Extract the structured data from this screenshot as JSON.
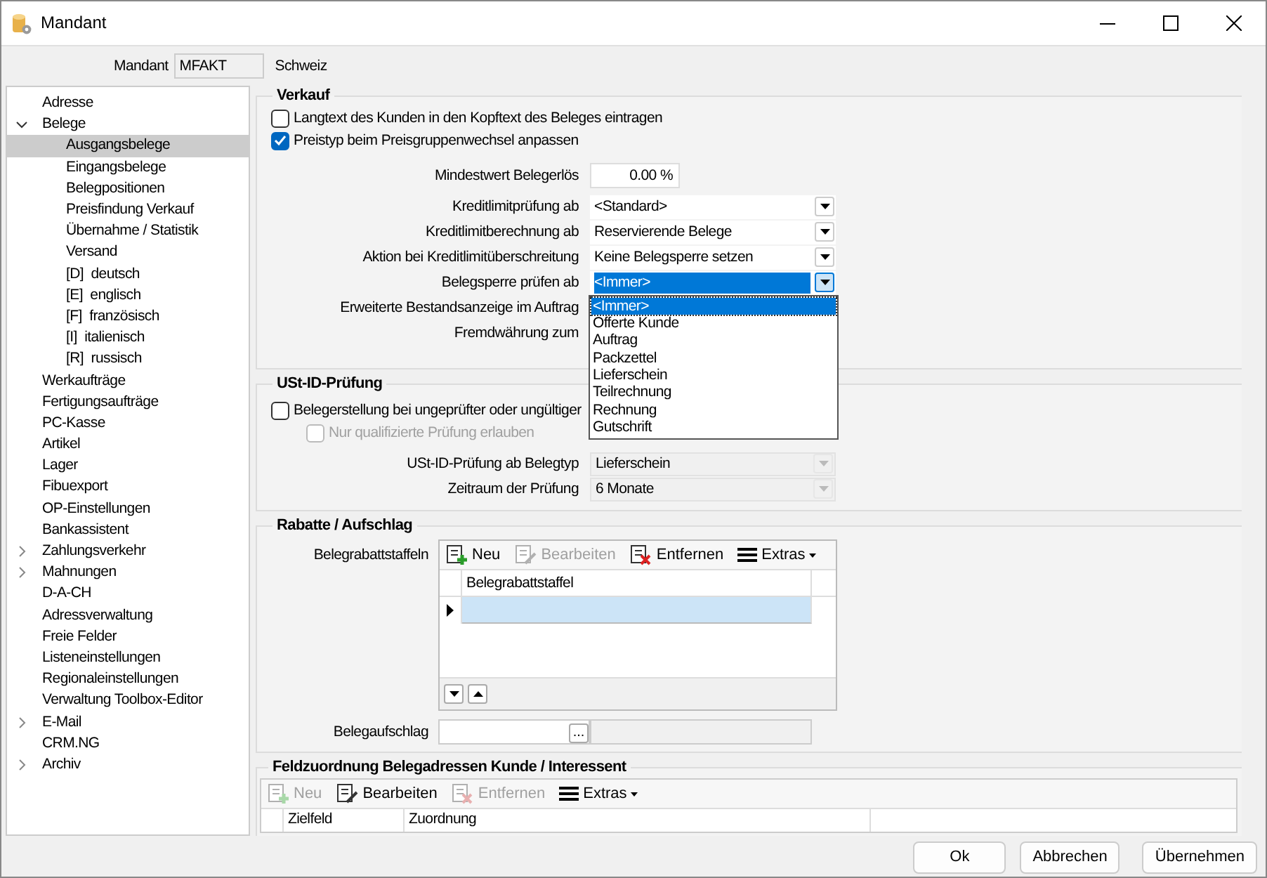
{
  "window": {
    "title": "Mandant"
  },
  "mandant": {
    "label": "Mandant",
    "code": "MFAKT",
    "name": "Schweiz"
  },
  "tree": [
    {
      "label": "Adresse",
      "selected": false
    },
    {
      "label": "Belege",
      "expanded": true,
      "selected": false,
      "children": [
        {
          "label": "Ausgangsbelege",
          "selected": true
        },
        {
          "label": "Eingangsbelege",
          "selected": false
        },
        {
          "label": "Belegpositionen",
          "selected": false
        },
        {
          "label": "Preisfindung Verkauf",
          "selected": false
        },
        {
          "label": "Übernahme / Statistik",
          "selected": false
        },
        {
          "label": "Versand",
          "selected": false
        },
        {
          "label": "[D]  deutsch",
          "selected": false
        },
        {
          "label": "[E]  englisch",
          "selected": false
        },
        {
          "label": "[F]  französisch",
          "selected": false
        },
        {
          "label": "[I]  italienisch",
          "selected": false
        },
        {
          "label": "[R]  russisch",
          "selected": false
        }
      ]
    },
    {
      "label": "Werkaufträge",
      "selected": false
    },
    {
      "label": "Fertigungsaufträge",
      "selected": false
    },
    {
      "label": "PC-Kasse",
      "selected": false
    },
    {
      "label": "Artikel",
      "selected": false
    },
    {
      "label": "Lager",
      "selected": false
    },
    {
      "label": "Fibuexport",
      "selected": false
    },
    {
      "label": "OP-Einstellungen",
      "selected": false
    },
    {
      "label": "Bankassistent",
      "selected": false
    },
    {
      "label": "Zahlungsverkehr",
      "expanded": false,
      "selected": false
    },
    {
      "label": "Mahnungen",
      "expanded": false,
      "selected": false
    },
    {
      "label": "D-A-CH",
      "selected": false
    },
    {
      "label": "Adressverwaltung",
      "selected": false
    },
    {
      "label": "Freie Felder",
      "selected": false
    },
    {
      "label": "Listeneinstellungen",
      "selected": false
    },
    {
      "label": "Regionaleinstellungen",
      "selected": false
    },
    {
      "label": "Verwaltung Toolbox-Editor",
      "selected": false
    },
    {
      "label": "E-Mail",
      "expanded": false,
      "selected": false
    },
    {
      "label": "CRM.NG",
      "selected": false
    },
    {
      "label": "Archiv",
      "expanded": false,
      "selected": false
    }
  ],
  "verkauf": {
    "title": "Verkauf",
    "checkboxes": [
      {
        "label": "Langtext des Kunden in den Kopftext des Beleges eintragen",
        "checked": false,
        "disabled": false
      },
      {
        "label": "Preistyp beim Preisgruppenwechsel anpassen",
        "checked": true,
        "disabled": false
      }
    ],
    "fields": [
      {
        "kind": "number",
        "label": "Mindestwert Belegerlös",
        "value": "0.00 %"
      },
      {
        "kind": "select",
        "label": "Kreditlimitprüfung ab",
        "value": "<Standard>",
        "focused": false,
        "disabled": false
      },
      {
        "kind": "select",
        "label": "Kreditlimitberechnung ab",
        "value": "Reservierende Belege",
        "focused": false,
        "disabled": false
      },
      {
        "kind": "select",
        "label": "Aktion bei Kreditlimitüberschreitung",
        "value": "Keine Belegsperre setzen",
        "focused": false,
        "disabled": false
      },
      {
        "kind": "select",
        "label": "Belegsperre prüfen ab",
        "value": "<Immer>",
        "focused": true,
        "disabled": false,
        "open": true
      },
      {
        "kind": "label",
        "label": "Erweiterte Bestandsanzeige im Auftrag"
      },
      {
        "kind": "label",
        "label": "Fremdwährung zum"
      }
    ]
  },
  "dropdown": {
    "options": [
      {
        "label": "<Immer>",
        "selected": true
      },
      {
        "label": "Offerte Kunde",
        "selected": false
      },
      {
        "label": "Auftrag",
        "selected": false
      },
      {
        "label": "Packzettel",
        "selected": false
      },
      {
        "label": "Lieferschein",
        "selected": false
      },
      {
        "label": "Teilrechnung",
        "selected": false
      },
      {
        "label": "Rechnung",
        "selected": false
      },
      {
        "label": "Gutschrift",
        "selected": false
      }
    ]
  },
  "ust": {
    "title": "USt-ID-Prüfung",
    "checkboxes": [
      {
        "label": "Belegerstellung bei ungeprüfter oder ungültiger",
        "checked": false,
        "disabled": false
      },
      {
        "label": "Nur qualifizierte Prüfung erlauben",
        "checked": false,
        "disabled": true
      }
    ],
    "fields": [
      {
        "kind": "select",
        "label": "USt-ID-Prüfung ab Belegtyp",
        "value": "Lieferschein",
        "focused": false,
        "disabled": true
      },
      {
        "kind": "select",
        "label": "Zeitraum der Prüfung",
        "value": "6 Monate",
        "focused": false,
        "disabled": true
      }
    ]
  },
  "rabatte": {
    "title": "Rabatte / Aufschlag",
    "grid_label": "Belegrabattstaffeln",
    "toolbar": [
      {
        "kind": "new",
        "label": "Neu",
        "disabled": false
      },
      {
        "kind": "edit",
        "label": "Bearbeiten",
        "disabled": true
      },
      {
        "kind": "delete",
        "label": "Entfernen",
        "disabled": false
      },
      {
        "kind": "menu",
        "label": "Extras",
        "disabled": false
      }
    ],
    "columns": [
      "Belegrabattstaffel"
    ],
    "rows": [
      {
        "selected": true
      }
    ],
    "aufschlag_label": "Belegaufschlag",
    "aufschlag_button": "..."
  },
  "feldzuordnung": {
    "title": "Feldzuordnung Belegadressen Kunde / Interessent",
    "toolbar": [
      {
        "kind": "new",
        "label": "Neu",
        "disabled": true
      },
      {
        "kind": "edit",
        "label": "Bearbeiten",
        "disabled": false
      },
      {
        "kind": "delete",
        "label": "Entfernen",
        "disabled": true
      },
      {
        "kind": "menu",
        "label": "Extras",
        "disabled": false
      }
    ],
    "columns": [
      "Zielfeld",
      "Zuordnung"
    ]
  },
  "buttons": [
    "Ok",
    "Abbrechen",
    "Übernehmen"
  ]
}
